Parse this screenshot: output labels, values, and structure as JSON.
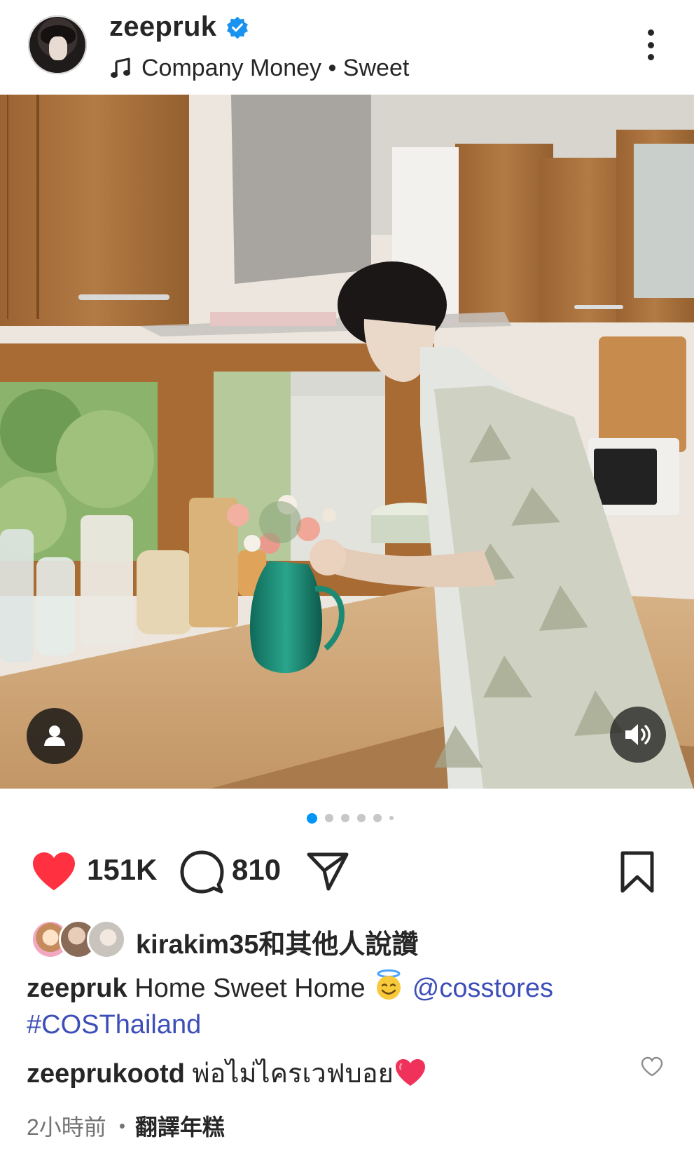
{
  "header": {
    "username": "zeepruk",
    "verified": true,
    "music_label": "Company Money • Sweet",
    "music_icon": "music-note-icon",
    "more_icon": "more-vertical-icon"
  },
  "media": {
    "carousel_count": 6,
    "active_index": 0,
    "user_tag_icon": "person-icon",
    "sound_icon": "speaker-icon"
  },
  "actions": {
    "like_count": "151K",
    "comment_count": "810",
    "liked": true,
    "like_color": "#ff3040"
  },
  "likes": {
    "text": "kirakim35和其他人說讚"
  },
  "caption": {
    "username": "zeepruk",
    "text": "Home Sweet Home",
    "emoji": "smiling-face-with-halo",
    "mention": "@cosstores",
    "hashtag": "#COSThailand",
    "link_color": "#3d4eb8"
  },
  "comment": {
    "username": "zeeprukootd",
    "text": "พ่อไม่ไครเวฟบอย",
    "emoji": "red-heart"
  },
  "meta": {
    "time": "2小時前",
    "separator": "•",
    "translate": "翻譯年糕"
  }
}
